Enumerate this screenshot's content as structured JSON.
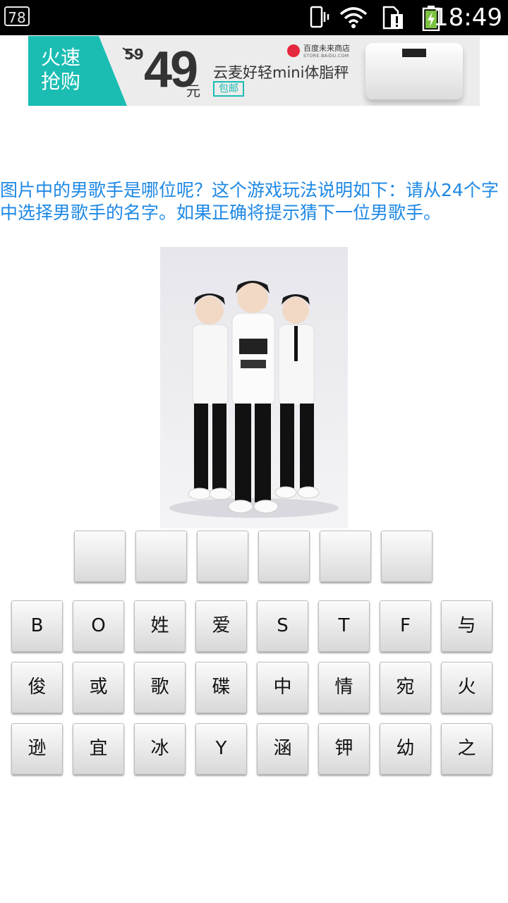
{
  "status_bar": {
    "notification_badge": "78",
    "time": "18:49",
    "icons": [
      "vibrate-icon",
      "wifi-icon",
      "sim-alert-icon",
      "battery-charging-icon"
    ]
  },
  "ad": {
    "slogan": "火速抢购",
    "old_price": "59",
    "price": "49",
    "price_unit": "元",
    "store_name": "百度未来商店",
    "store_sub": "STORE.BAIDU.COM",
    "product": "云麦好轻mini体脂秤",
    "free_shipping": "包邮",
    "accent_color": "#1bbdb3"
  },
  "question": "图片中的男歌手是哪位呢？这个游戏玩法说明如下：请从24个字中选择男歌手的名字。如果正确将提示猜下一位男歌手。",
  "question_color": "#1e88e5",
  "answer_slots": [
    "",
    "",
    "",
    "",
    "",
    ""
  ],
  "keyboard": {
    "rows": [
      [
        "B",
        "O",
        "姓",
        "爱",
        "S",
        "T",
        "F",
        "与"
      ],
      [
        "俊",
        "或",
        "歌",
        "碟",
        "中",
        "情",
        "宛",
        "火"
      ],
      [
        "逊",
        "宜",
        "冰",
        "Y",
        "涵",
        "钾",
        "幼",
        "之"
      ]
    ]
  }
}
